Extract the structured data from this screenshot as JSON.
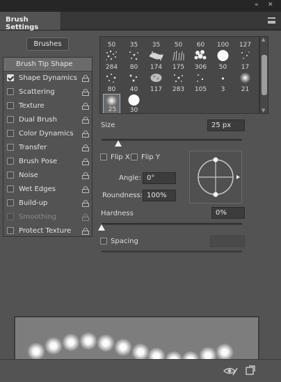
{
  "window": {
    "collapse_icon": "double-chevron-left-icon",
    "close_icon": "close-icon"
  },
  "tab": {
    "title": "Brush Settings",
    "menu_icon": "hamburger-menu-icon"
  },
  "buttons": {
    "brushes": "Brushes"
  },
  "options": [
    {
      "label": "Brush Tip Shape",
      "checked": null,
      "enabled": true
    },
    {
      "label": "Shape Dynamics",
      "checked": true,
      "enabled": true
    },
    {
      "label": "Scattering",
      "checked": false,
      "enabled": true
    },
    {
      "label": "Texture",
      "checked": false,
      "enabled": true
    },
    {
      "label": "Dual Brush",
      "checked": false,
      "enabled": true
    },
    {
      "label": "Color Dynamics",
      "checked": false,
      "enabled": true
    },
    {
      "label": "Transfer",
      "checked": false,
      "enabled": true
    },
    {
      "label": "Brush Pose",
      "checked": false,
      "enabled": true
    },
    {
      "label": "Noise",
      "checked": false,
      "enabled": true
    },
    {
      "label": "Wet Edges",
      "checked": false,
      "enabled": true
    },
    {
      "label": "Build-up",
      "checked": false,
      "enabled": true
    },
    {
      "label": "Smoothing",
      "checked": false,
      "enabled": false
    },
    {
      "label": "Protect Texture",
      "checked": false,
      "enabled": true
    }
  ],
  "brush_grid": {
    "row1": [
      "50",
      "35",
      "35",
      "50",
      "60",
      "100",
      "127"
    ],
    "row2": [
      "284",
      "80",
      "174",
      "175",
      "306",
      "50",
      "17"
    ],
    "row3": [
      "80",
      "40",
      "117",
      "283",
      "105",
      "3",
      "21"
    ],
    "row4": [
      "25",
      "30"
    ],
    "selected": "25"
  },
  "size": {
    "label": "Size",
    "value": "25 px",
    "slider_fraction": 0.12
  },
  "flip": {
    "x_label": "Flip X",
    "y_label": "Flip Y",
    "x_checked": false,
    "y_checked": false
  },
  "angle": {
    "label": "Angle:",
    "value": "0°"
  },
  "roundness": {
    "label": "Roundness:",
    "value": "100%"
  },
  "hardness": {
    "label": "Hardness",
    "value": "0%",
    "slider_fraction": 0.0
  },
  "spacing": {
    "label": "Spacing",
    "checked": false,
    "value": ""
  },
  "bottom": {
    "icons": [
      "eye-brush-icon",
      "new-preset-icon"
    ]
  }
}
